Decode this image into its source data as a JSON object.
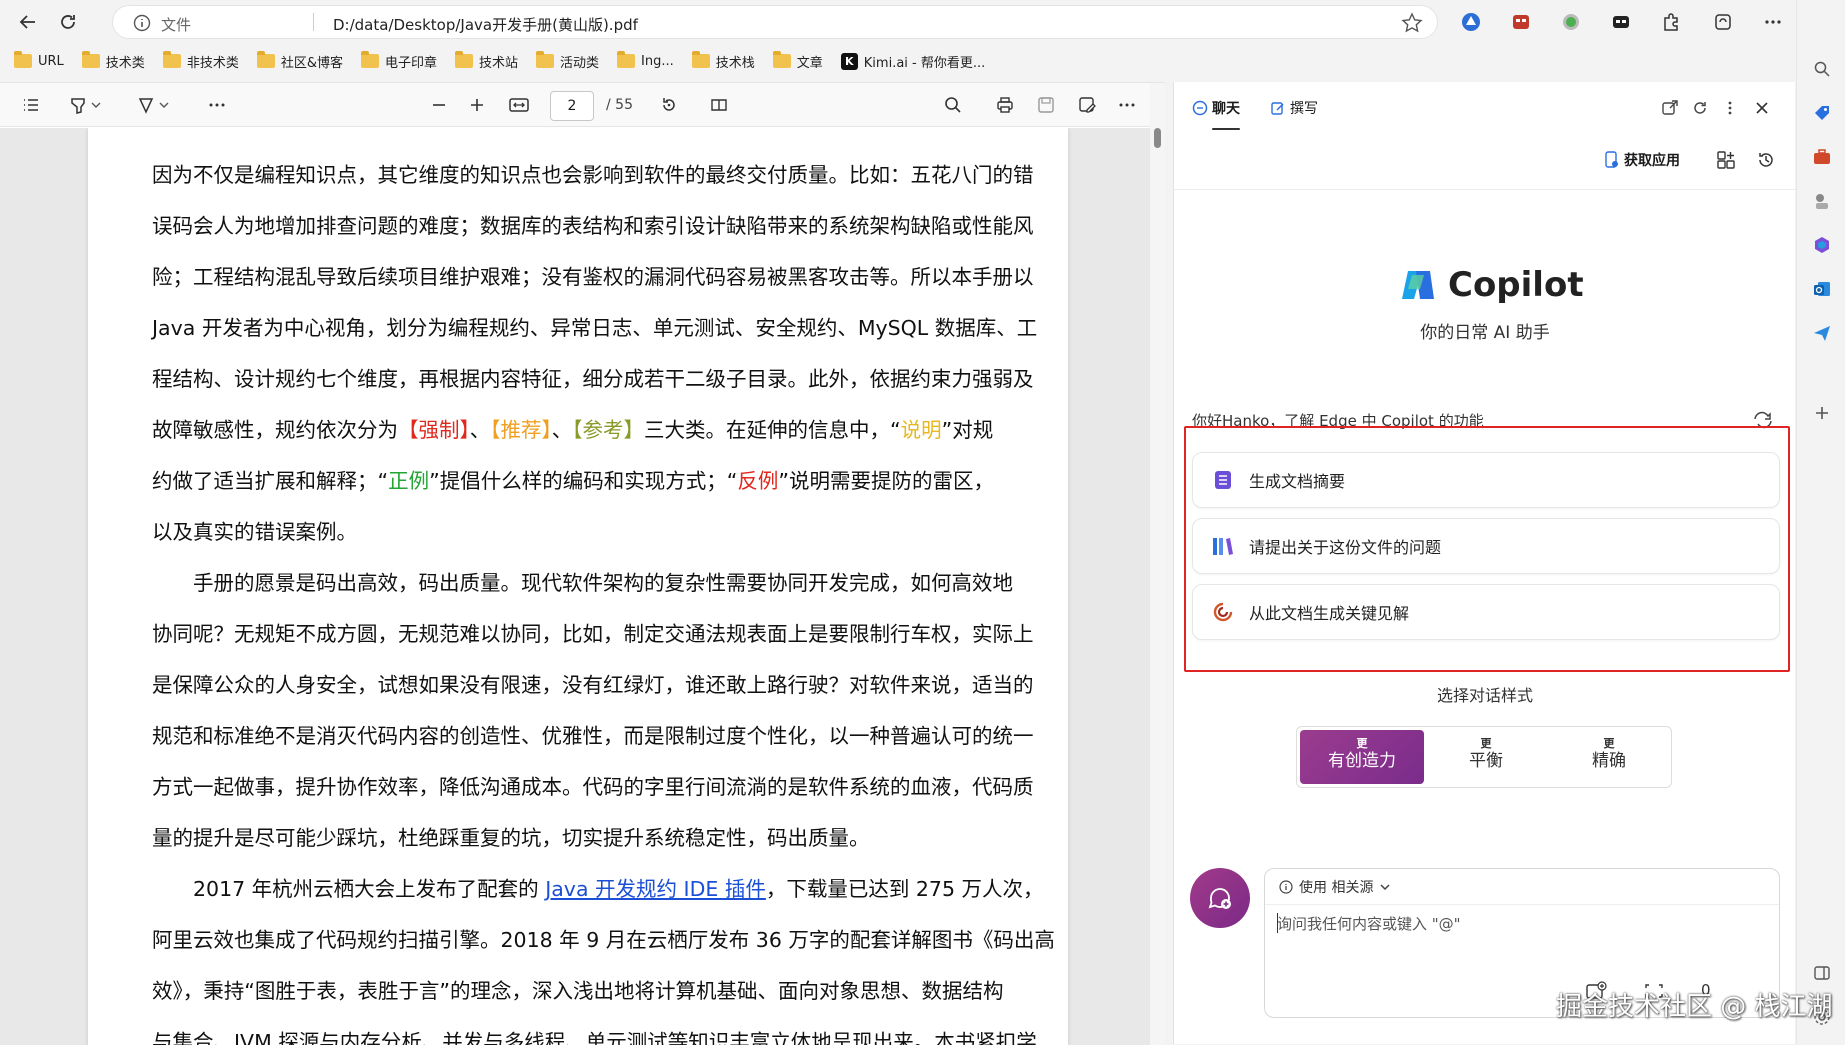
{
  "browser": {
    "address": {
      "protocol_label": "文件",
      "url": "D:/data/Desktop/Java开发手册(黄山版).pdf"
    }
  },
  "bookmarks": [
    {
      "label": "URL",
      "type": "folder"
    },
    {
      "label": "技术类",
      "type": "folder"
    },
    {
      "label": "非技术类",
      "type": "folder"
    },
    {
      "label": "社区&博客",
      "type": "folder"
    },
    {
      "label": "电子印章",
      "type": "folder"
    },
    {
      "label": "技术站",
      "type": "folder"
    },
    {
      "label": "活动类",
      "type": "folder"
    },
    {
      "label": "Ing...",
      "type": "folder"
    },
    {
      "label": "技术栈",
      "type": "folder"
    },
    {
      "label": "文章",
      "type": "folder"
    },
    {
      "label": "Kimi.ai - 帮你看更...",
      "type": "site",
      "icon_text": "K"
    }
  ],
  "pdf": {
    "current_page": "2",
    "total_pages": "/ 55",
    "lines": [
      [
        {
          "t": "因为不仅是编程知识点，其它维度的知识点也会影响到软件的最终交付质量。比如：五花八门的错"
        }
      ],
      [
        {
          "t": "误码会人为地增加排查问题的难度；数据库的表结构和索引设计缺陷带来的系统架构缺陷或性能风"
        }
      ],
      [
        {
          "t": "险；工程结构混乱导致后续项目维护艰难；没有鉴权的漏洞代码容易被黑客攻击等。所以本手册以"
        }
      ],
      [
        {
          "t": "Java 开发者为中心视角，划分为编程规约、异常日志、单元测试、安全规约、MySQL 数据库、工"
        }
      ],
      [
        {
          "t": "程结构、设计规约七个维度，再根据内容特征，细分成若干二级子目录。此外，依据约束力强弱及"
        }
      ],
      [
        {
          "t": "故障敏感性，规约依次分为"
        },
        {
          "t": "【强制】",
          "c": "red"
        },
        {
          "t": "、"
        },
        {
          "t": "【推荐】",
          "c": "orange"
        },
        {
          "t": "、"
        },
        {
          "t": "【参考】",
          "c": "olive"
        },
        {
          "t": "三大类。在延伸的信息中，“"
        },
        {
          "t": "说明",
          "c": "yellow"
        },
        {
          "t": "”对规"
        }
      ],
      [
        {
          "t": "约做了适当扩展和解释；“"
        },
        {
          "t": "正例",
          "c": "green"
        },
        {
          "t": "”提倡什么样的编码和实现方式；“"
        },
        {
          "t": "反例",
          "c": "red"
        },
        {
          "t": "”说明需要提防的雷区，"
        }
      ],
      [
        {
          "t": "以及真实的错误案例。"
        }
      ],
      [
        {
          "t": "　　手册的愿景是码出高效，码出质量。现代软件架构的复杂性需要协同开发完成，如何高效地"
        }
      ],
      [
        {
          "t": "协同呢？无规矩不成方圆，无规范难以协同，比如，制定交通法规表面上是要限制行车权，实际上"
        }
      ],
      [
        {
          "t": "是保障公众的人身安全，试想如果没有限速，没有红绿灯，谁还敢上路行驶？对软件来说，适当的"
        }
      ],
      [
        {
          "t": "规范和标准绝不是消灭代码内容的创造性、优雅性，而是限制过度个性化，以一种普遍认可的统一"
        }
      ],
      [
        {
          "t": "方式一起做事，提升协作效率，降低沟通成本。代码的字里行间流淌的是软件系统的血液，代码质"
        }
      ],
      [
        {
          "t": "量的提升是尽可能少踩坑，杜绝踩重复的坑，切实提升系统稳定性，码出质量。"
        }
      ],
      [
        {
          "t": "　　2017 年杭州云栖大会上发布了配套的 "
        },
        {
          "t": "Java 开发规约 IDE 插件",
          "c": "link"
        },
        {
          "t": "，下载量已达到 275 万人次，"
        }
      ],
      [
        {
          "t": "阿里云效也集成了代码规约扫描引擎。2018 年 9 月在云栖厅发布 36 万字的配套详解图书《码出高"
        }
      ],
      [
        {
          "t": "效》，秉持“图胜于表，表胜于言”的理念，深入浅出地将计算机基础、面向对象思想、数据结构"
        }
      ],
      [
        {
          "t": "与集合、JVM 探源与内存分析、并发与多线程、单元测试等知识丰富立体地呈现出来。本书紧扣学"
        }
      ]
    ]
  },
  "copilot": {
    "tabs": {
      "chat": "聊天",
      "compose": "撰写"
    },
    "get_apps": "获取应用",
    "brand": "Copilot",
    "tagline": "你的日常 AI 助手",
    "greeting": "你好Hanko，了解 Edge 中 Copilot 的功能",
    "suggestions": [
      {
        "label": "生成文档摘要",
        "icon": "list-doc-icon"
      },
      {
        "label": "请提出关于这份文件的问题",
        "icon": "books-icon"
      },
      {
        "label": "从此文档生成关键见解",
        "icon": "insight-swirl-icon"
      }
    ],
    "style_label": "选择对话样式",
    "styles": [
      {
        "small": "更",
        "big": "有创造力",
        "active": true
      },
      {
        "small": "更",
        "big": "平衡",
        "active": false
      },
      {
        "small": "更",
        "big": "精确",
        "active": false
      }
    ],
    "source_label": "使用 相关源",
    "input_placeholder": "询问我任何内容或键入 \"@\"",
    "char_count": "0"
  },
  "watermark": "掘金技术社区 @ 栈江湖",
  "colors": {
    "accent_purple": "#7b2a86",
    "highlight_red": "#e02424",
    "link_blue": "#1a4fd6"
  }
}
